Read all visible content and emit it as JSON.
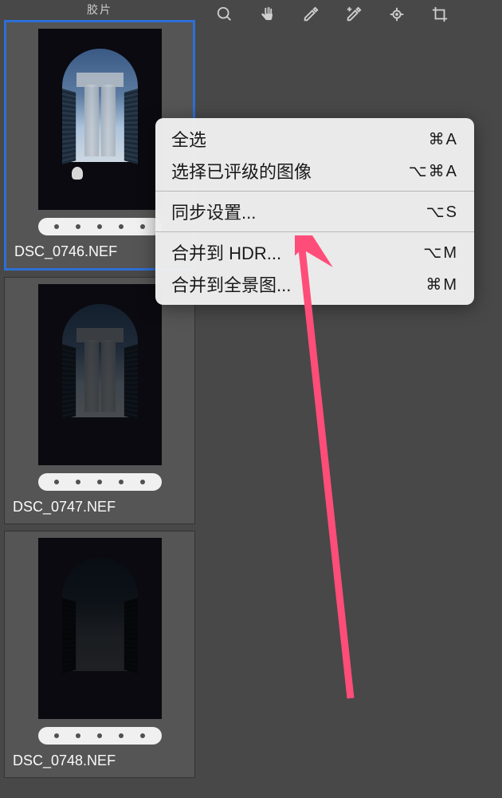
{
  "sidebar": {
    "header": "胶片",
    "thumbnails": [
      {
        "filename": "DSC_0746.NEF",
        "selected": true,
        "brightness": "normal"
      },
      {
        "filename": "DSC_0747.NEF",
        "selected": false,
        "brightness": "dark1"
      },
      {
        "filename": "DSC_0748.NEF",
        "selected": false,
        "brightness": "dark2"
      }
    ]
  },
  "toolbar": {
    "tools": [
      "zoom",
      "hand",
      "eyedropper",
      "eyedropper-plus",
      "target-adjust",
      "crop"
    ]
  },
  "contextMenu": {
    "groups": [
      [
        {
          "label": "全选",
          "shortcut": "⌘A"
        },
        {
          "label": "选择已评级的图像",
          "shortcut": "⌥⌘A"
        }
      ],
      [
        {
          "label": "同步设置...",
          "shortcut": "⌥S"
        }
      ],
      [
        {
          "label": "合并到 HDR...",
          "shortcut": "⌥M"
        },
        {
          "label": "合并到全景图...",
          "shortcut": "⌘M"
        }
      ]
    ]
  },
  "annotation": {
    "color": "#ff4d79"
  }
}
